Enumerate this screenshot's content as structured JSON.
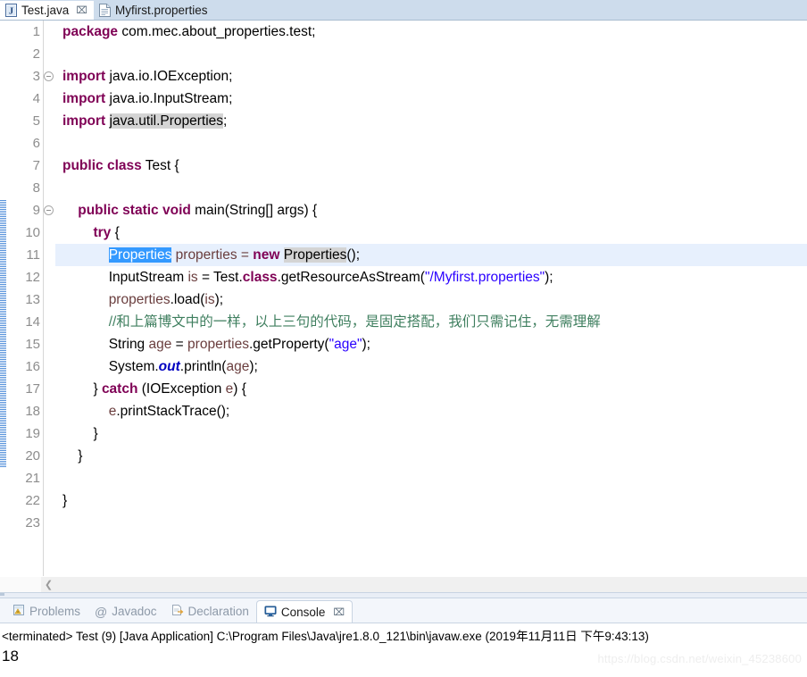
{
  "editor": {
    "tabs": [
      {
        "label": "Test.java",
        "icon": "java-file-icon",
        "active": true,
        "closable": true
      },
      {
        "label": "Myfirst.properties",
        "icon": "properties-file-icon",
        "active": false,
        "closable": false
      }
    ],
    "close_glyph": "⌧",
    "lines": [
      {
        "n": "1",
        "fold": false,
        "changed": false,
        "current": false
      },
      {
        "n": "2",
        "fold": false,
        "changed": false,
        "current": false
      },
      {
        "n": "3",
        "fold": true,
        "changed": false,
        "current": false
      },
      {
        "n": "4",
        "fold": false,
        "changed": false,
        "current": false
      },
      {
        "n": "5",
        "fold": false,
        "changed": false,
        "current": false
      },
      {
        "n": "6",
        "fold": false,
        "changed": false,
        "current": false
      },
      {
        "n": "7",
        "fold": false,
        "changed": false,
        "current": false
      },
      {
        "n": "8",
        "fold": false,
        "changed": false,
        "current": false
      },
      {
        "n": "9",
        "fold": true,
        "changed": true,
        "current": false
      },
      {
        "n": "10",
        "fold": false,
        "changed": true,
        "current": false
      },
      {
        "n": "11",
        "fold": false,
        "changed": true,
        "current": true
      },
      {
        "n": "12",
        "fold": false,
        "changed": true,
        "current": false
      },
      {
        "n": "13",
        "fold": false,
        "changed": true,
        "current": false
      },
      {
        "n": "14",
        "fold": false,
        "changed": true,
        "current": false
      },
      {
        "n": "15",
        "fold": false,
        "changed": true,
        "current": false
      },
      {
        "n": "16",
        "fold": false,
        "changed": true,
        "current": false
      },
      {
        "n": "17",
        "fold": false,
        "changed": true,
        "current": false
      },
      {
        "n": "18",
        "fold": false,
        "changed": true,
        "current": false
      },
      {
        "n": "19",
        "fold": false,
        "changed": true,
        "current": false
      },
      {
        "n": "20",
        "fold": false,
        "changed": true,
        "current": false
      },
      {
        "n": "21",
        "fold": false,
        "changed": false,
        "current": false
      },
      {
        "n": "22",
        "fold": false,
        "changed": false,
        "current": false
      },
      {
        "n": "23",
        "fold": false,
        "changed": false,
        "current": false
      }
    ],
    "code": {
      "l1_kw": "package",
      "l1_rest": " com.mec.about_properties.test;",
      "l3_kw": "import",
      "l3_rest": " java.io.IOException;",
      "l4_kw": "import",
      "l4_rest": " java.io.InputStream;",
      "l5_kw": "import",
      "l5_sp": " ",
      "l5_occ": "java.util.Properties",
      "l5_end": ";",
      "l7_kw": "public class",
      "l7_rest": " Test {",
      "l9_ind": "    ",
      "l9_kw": "public static void",
      "l9_rest": " main(String[] args) {",
      "l10_ind": "        ",
      "l10_kw": "try",
      "l10_rest": " {",
      "l11_ind": "            ",
      "l11_sel": "Properties",
      "l11_mid": " ",
      "l11_var": "properties",
      "l11_eq": " = ",
      "l11_kw": "new",
      "l11_sp": " ",
      "l11_occ": "Properties",
      "l11_end": "();",
      "l12_ind": "            ",
      "l12_type": "InputStream ",
      "l12_var": "is",
      "l12_mid": " = Test.",
      "l12_kw": "class",
      "l12_call": ".getResourceAsStream(",
      "l12_str": "\"/Myfirst.properties\"",
      "l12_end": ");",
      "l13_ind": "            ",
      "l13_var": "properties",
      "l13_mid": ".load(",
      "l13_var2": "is",
      "l13_end": ");",
      "l14_ind": "            ",
      "l14_cmt": "//和上篇博文中的一样，以上三句的代码，是固定搭配，我们只需记住，无需理解",
      "l15_ind": "            ",
      "l15_type": "String ",
      "l15_var": "age",
      "l15_mid": " = ",
      "l15_var2": "properties",
      "l15_call": ".getProperty(",
      "l15_str": "\"age\"",
      "l15_end": ");",
      "l16_ind": "            ",
      "l16_sys": "System.",
      "l16_fld": "out",
      "l16_call": ".println(",
      "l16_var": "age",
      "l16_end": ");",
      "l17_ind": "        ",
      "l17_brace": "} ",
      "l17_kw": "catch",
      "l17_mid": " (IOException ",
      "l17_var": "e",
      "l17_end": ") {",
      "l18_ind": "            ",
      "l18_var": "e",
      "l18_rest": ".printStackTrace();",
      "l19_ind": "        ",
      "l19_rest": "}",
      "l20_ind": "    ",
      "l20_rest": "}",
      "l22_rest": "}"
    },
    "hscroll_arrow": "❮"
  },
  "bottom_view": {
    "tabs": [
      {
        "label": "Problems",
        "icon": "problems-icon",
        "active": false,
        "closable": false
      },
      {
        "label": "Javadoc",
        "icon": "javadoc-icon",
        "active": false,
        "closable": false
      },
      {
        "label": "Declaration",
        "icon": "declaration-icon",
        "active": false,
        "closable": false
      },
      {
        "label": "Console",
        "icon": "console-icon",
        "active": true,
        "closable": true
      }
    ],
    "close_glyph": "⌧",
    "console": {
      "header": "<terminated> Test (9) [Java Application] C:\\Program Files\\Java\\jre1.8.0_121\\bin\\javaw.exe (2019年11月11日 下午9:43:13)",
      "output": "18"
    }
  },
  "watermark": "https://blog.csdn.net/weixin_45238600",
  "colors": {
    "tab_active_bg": "#ffffff",
    "tab_inactive_bg": "#cddcec",
    "keyword": "#7f0055",
    "string": "#2a00ff",
    "comment": "#3f7f5f",
    "local_var": "#6a3e3e",
    "static_field": "#0000c0",
    "selection": "#3399ff",
    "occurrence": "#d4d4d4",
    "current_line": "#e7f0fd",
    "changebar": "#3a7fd5"
  }
}
